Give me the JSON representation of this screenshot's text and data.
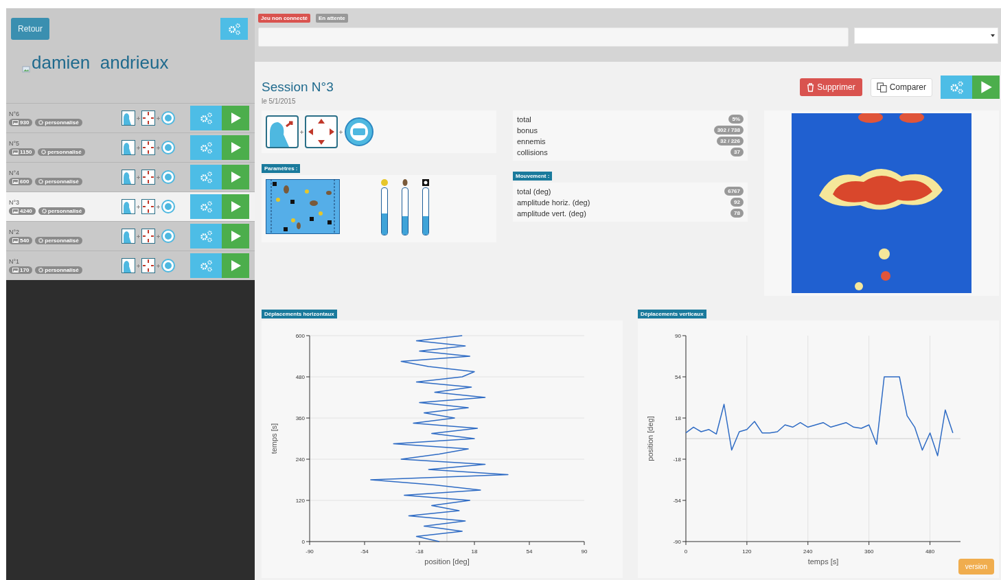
{
  "sidebar": {
    "back_button": "Retour",
    "user_name": "damien  andrieux",
    "sessions": [
      {
        "number": "N°6",
        "points": "930",
        "mode": "personnalisé",
        "selected": false
      },
      {
        "number": "N°5",
        "points": "1150",
        "mode": "personnalisé",
        "selected": false
      },
      {
        "number": "N°4",
        "points": "600",
        "mode": "personnalisé",
        "selected": false
      },
      {
        "number": "N°3",
        "points": "4240",
        "mode": "personnalisé",
        "selected": true
      },
      {
        "number": "N°2",
        "points": "540",
        "mode": "personnalisé",
        "selected": false
      },
      {
        "number": "N°1",
        "points": "170",
        "mode": "personnalisé",
        "selected": false
      }
    ]
  },
  "status_badges": [
    {
      "label": "Jeu non connecté",
      "color": "#d9534f"
    },
    {
      "label": "En attente",
      "color": "#999999"
    }
  ],
  "session": {
    "title": "Session N°3",
    "date": "le 5/1/2015",
    "delete_button": "Supprimer",
    "compare_button": "Comparer"
  },
  "parameters": {
    "label": "Paramètres :",
    "sliders": [
      {
        "level": 0.45
      },
      {
        "level": 0.4
      },
      {
        "level": 0.4
      }
    ]
  },
  "scores": [
    {
      "label": "total",
      "value": "5%"
    },
    {
      "label": "bonus",
      "value": "302 / 738"
    },
    {
      "label": "ennemis",
      "value": "32 / 226"
    },
    {
      "label": "collisions",
      "value": "37"
    }
  ],
  "movement": {
    "label": "Mouvement :",
    "rows": [
      {
        "label": "total (deg)",
        "value": "6767"
      },
      {
        "label": "amplitude horiz. (deg)",
        "value": "92"
      },
      {
        "label": "amplitude vert. (deg)",
        "value": "78"
      }
    ]
  },
  "charts": [
    {
      "label": "Déplacements horizontaux",
      "chart_data": {
        "type": "line",
        "orientation": "horizontal",
        "xlabel": "position [deg]",
        "ylabel": "temps [s]",
        "xlim": [
          -90,
          90
        ],
        "ylim": [
          0,
          600
        ],
        "xticks": [
          -90,
          -54,
          -18,
          18,
          54,
          90
        ],
        "yticks": [
          0,
          120,
          240,
          360,
          480,
          600
        ],
        "x": [
          0,
          15,
          30,
          45,
          60,
          75,
          90,
          105,
          120,
          135,
          150,
          165,
          180,
          195,
          210,
          225,
          240,
          255,
          270,
          285,
          300,
          315,
          330,
          345,
          360,
          375,
          390,
          405,
          420,
          435,
          450,
          465,
          480,
          495,
          510,
          525,
          540,
          555,
          570,
          585,
          600
        ],
        "grid": true,
        "series": [
          {
            "color": "#2e6bc4",
            "values": [
              -5,
              -20,
              10,
              -15,
              12,
              -25,
              8,
              -10,
              15,
              -28,
              22,
              -8,
              -50,
              40,
              -12,
              25,
              -30,
              -5,
              14,
              -35,
              18,
              -10,
              20,
              -22,
              5,
              -15,
              14,
              -18,
              25,
              -8,
              16,
              -20,
              10,
              18,
              -12,
              -30,
              15,
              -18,
              12,
              -20,
              10
            ]
          }
        ]
      }
    },
    {
      "label": "Déplacements verticaux",
      "chart_data": {
        "type": "line",
        "xlabel": "temps [s]",
        "ylabel": "position [deg]",
        "xlim": [
          0,
          540
        ],
        "ylim": [
          -90,
          90
        ],
        "xticks": [
          0,
          120,
          240,
          360,
          480
        ],
        "yticks": [
          -90,
          -54,
          -18,
          18,
          54,
          90
        ],
        "x": [
          0,
          15,
          30,
          45,
          60,
          75,
          90,
          105,
          120,
          135,
          150,
          165,
          180,
          195,
          210,
          225,
          240,
          255,
          270,
          285,
          300,
          315,
          330,
          345,
          360,
          375,
          390,
          405,
          420,
          435,
          450,
          465,
          480,
          495,
          510,
          525
        ],
        "grid": true,
        "series": [
          {
            "color": "#2e6bc4",
            "values": [
              5,
              10,
              6,
              8,
              4,
              30,
              -10,
              6,
              8,
              15,
              5,
              5,
              6,
              12,
              10,
              14,
              10,
              12,
              14,
              10,
              12,
              14,
              10,
              9,
              12,
              -5,
              54,
              54,
              54,
              20,
              10,
              -10,
              5,
              -15,
              25,
              5
            ]
          }
        ]
      }
    }
  ],
  "version_button": "version"
}
